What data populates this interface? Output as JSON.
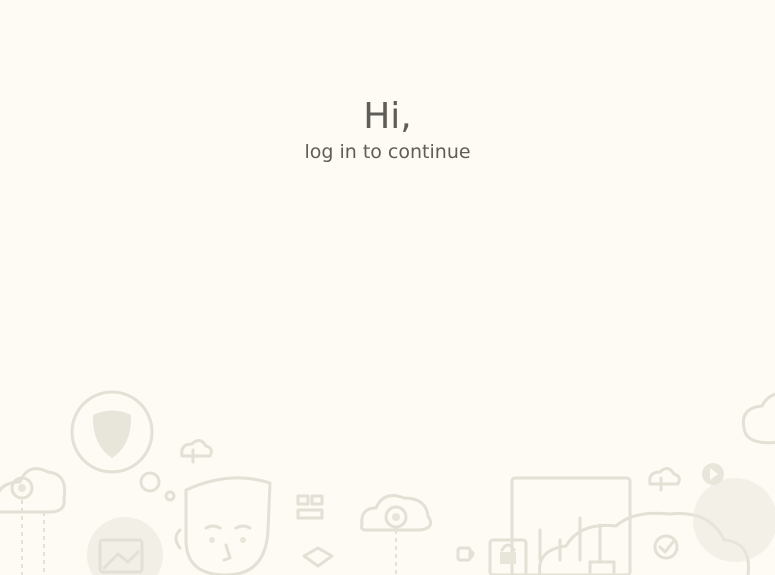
{
  "login": {
    "title": "Hi,",
    "subtitle": "log in to continue"
  },
  "illustration": {
    "icons": [
      "shield-icon",
      "cloud-upload-icon",
      "person-icon",
      "chart-icon",
      "lock-icon",
      "checkmark-cloud-icon",
      "coffee-icon",
      "flowchart-icon",
      "image-icon",
      "play-icon"
    ]
  },
  "colors": {
    "background": "#fdfbf3",
    "text": "#5f5d58",
    "doodle": "#e3e0d6"
  }
}
